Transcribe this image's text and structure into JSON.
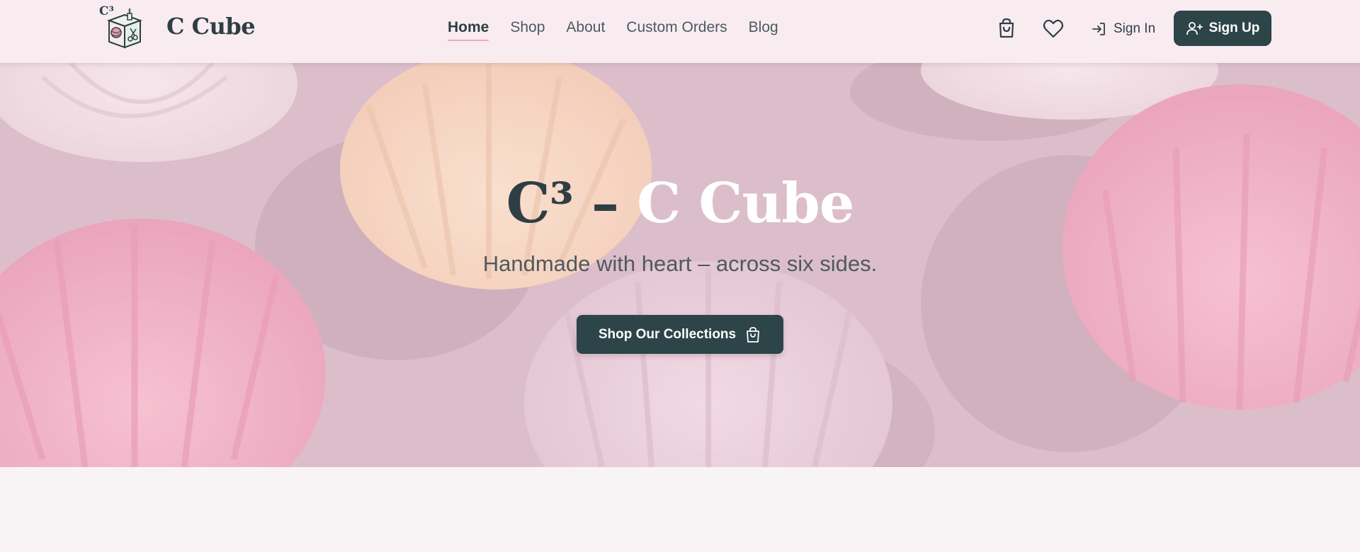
{
  "brand": {
    "logo_text": "C³",
    "name": "C Cube"
  },
  "nav": {
    "items": [
      {
        "label": "Home",
        "active": true
      },
      {
        "label": "Shop",
        "active": false
      },
      {
        "label": "About",
        "active": false
      },
      {
        "label": "Custom Orders",
        "active": false
      },
      {
        "label": "Blog",
        "active": false
      }
    ]
  },
  "header_actions": {
    "cart_icon": "shopping-bag-icon",
    "wishlist_icon": "heart-icon",
    "signin_label": "Sign In",
    "signin_icon": "sign-in-icon",
    "signup_label": "Sign Up",
    "signup_icon": "user-plus-icon"
  },
  "hero": {
    "title_part1": "C³ – ",
    "title_part2": "C Cube",
    "subtitle": "Handmade with heart – across six sides.",
    "cta_label": "Shop Our Collections",
    "cta_icon": "shopping-bag-icon",
    "background": "pink-shell-dishes-photo"
  },
  "colors": {
    "primary": "#2d4449",
    "header_bg": "#f8ecf1",
    "accent_pink": "#f2a9bf",
    "page_bg": "#f8f4f5"
  }
}
